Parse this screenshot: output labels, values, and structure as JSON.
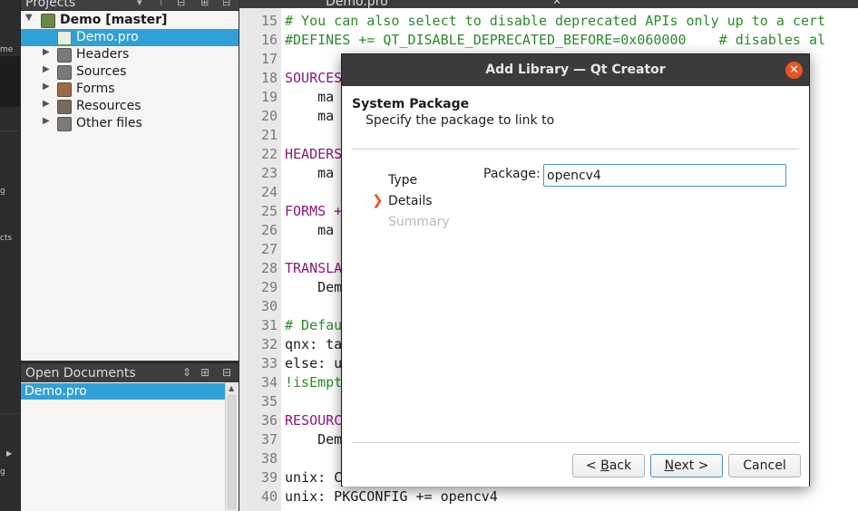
{
  "modebar": {
    "labels": [
      "me",
      "g",
      "cts"
    ]
  },
  "projects": {
    "header_title": "Projects",
    "tree": [
      {
        "label": "Demo [master]",
        "bold": true,
        "expanded": true,
        "icon": "project-icon"
      },
      {
        "label": "Demo.pro",
        "selected": true,
        "icon": "pro-file-icon"
      },
      {
        "label": "Headers",
        "icon": "headers-folder-icon"
      },
      {
        "label": "Sources",
        "icon": "sources-folder-icon"
      },
      {
        "label": "Forms",
        "icon": "forms-folder-icon"
      },
      {
        "label": "Resources",
        "icon": "resources-folder-icon"
      },
      {
        "label": "Other files",
        "icon": "other-files-folder-icon"
      }
    ]
  },
  "open_documents": {
    "header_title": "Open Documents",
    "items": [
      "Demo.pro"
    ]
  },
  "editor": {
    "tab_title": "Demo.pro",
    "line_numbers": [
      "15",
      "16",
      "17",
      "18",
      "19",
      "20",
      "21",
      "22",
      "23",
      "24",
      "25",
      "26",
      "27",
      "28",
      "29",
      "30",
      "31",
      "32",
      "33",
      "34",
      "35",
      "36",
      "37",
      "38",
      "39",
      "40"
    ],
    "lines": {
      "15": "# You can also select to disable deprecated APIs only up to a cert",
      "16": "#DEFINES += QT_DISABLE_DEPRECATED_BEFORE=0x060000    # disables al",
      "17": "",
      "18": "SOURCES",
      "19": "    ma",
      "20": "    ma",
      "21": "",
      "22": "HEADERS",
      "23": "    ma",
      "24": "",
      "25": "FORMS +",
      "26": "    ma",
      "27": "",
      "28": "TRANSLA",
      "29": "    Dem",
      "30": "",
      "31": "# Defau",
      "32": "qnx: ta",
      "33": "else: u",
      "34": "!isEmpt",
      "35": "",
      "36": "RESOURC",
      "37": "    Dem",
      "38": "",
      "39": "unix: C",
      "40": "unix: PKGCONFIG += opencv4"
    }
  },
  "dialog": {
    "title": "Add Library — Qt Creator",
    "page_title": "System Package",
    "page_subtitle": "Specify the package to link to",
    "steps": [
      {
        "label": "Type",
        "state": "done"
      },
      {
        "label": "Details",
        "state": "current"
      },
      {
        "label": "Summary",
        "state": "pending"
      }
    ],
    "package_label": "Package:",
    "package_value": "opencv4",
    "back_mnemonic": "B",
    "back_rest": "ack",
    "back_prefix": "< ",
    "next_mnemonic": "N",
    "next_rest": "ext >",
    "cancel_label": "Cancel"
  },
  "colors": {
    "accent": "#e95420",
    "selection": "#30a0d8",
    "comment": "#2b8a2b"
  }
}
